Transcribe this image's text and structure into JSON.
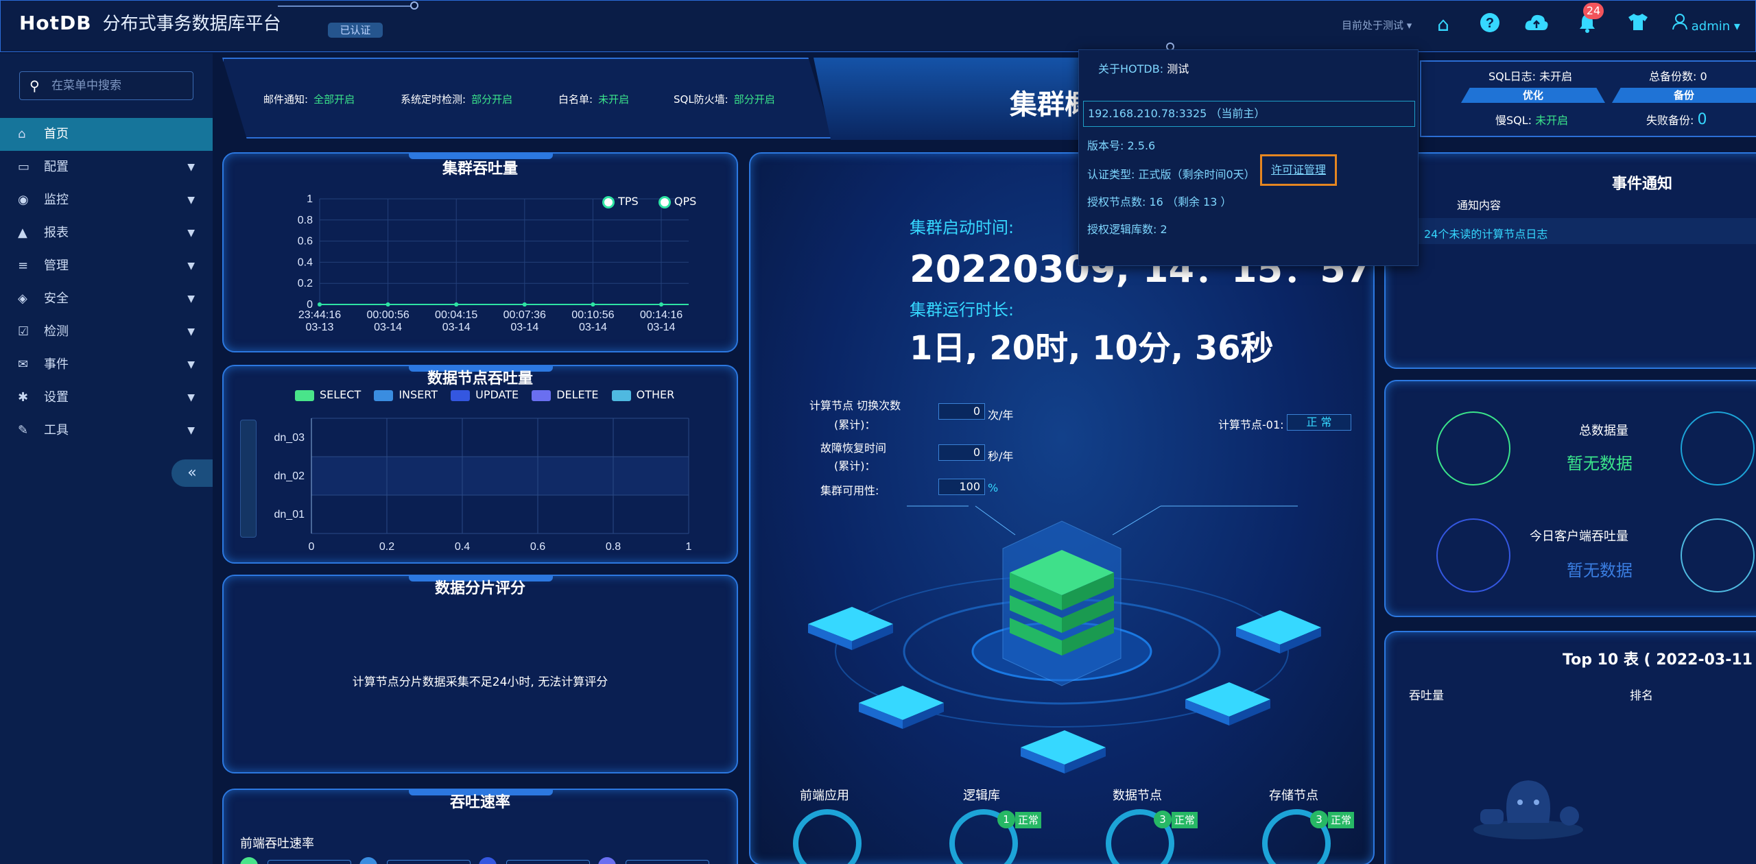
{
  "header": {
    "logo": "HotDB",
    "app_title": "分布式事务数据库平台",
    "cert_badge": "已认证",
    "env_selector": "目前处于测试",
    "notification_count": "24",
    "user": "admin",
    "icons": [
      "home-icon",
      "help-icon",
      "cloud-upload-icon",
      "bell-icon",
      "tshirt-icon",
      "user-icon"
    ]
  },
  "sidebar": {
    "search_placeholder": "在菜单中搜索",
    "collapse_label": "«",
    "items": [
      {
        "label": "首页",
        "icon": "home-icon",
        "active": true
      },
      {
        "label": "配置",
        "icon": "monitor-icon"
      },
      {
        "label": "监控",
        "icon": "eye-icon"
      },
      {
        "label": "报表",
        "icon": "chart-icon"
      },
      {
        "label": "管理",
        "icon": "database-icon"
      },
      {
        "label": "安全",
        "icon": "shield-icon"
      },
      {
        "label": "检测",
        "icon": "check-icon"
      },
      {
        "label": "事件",
        "icon": "mail-icon"
      },
      {
        "label": "设置",
        "icon": "gear-icon"
      },
      {
        "label": "工具",
        "icon": "wrench-icon"
      }
    ]
  },
  "settings_strip": [
    {
      "label": "邮件通知:",
      "value": "全部开启"
    },
    {
      "label": "系统定时检测:",
      "value": "部分开启"
    },
    {
      "label": "白名单:",
      "value": "未开启"
    },
    {
      "label": "SQL防火墙:",
      "value": "部分开启"
    }
  ],
  "center_title": "集群概",
  "right_strip": {
    "sql_log_label": "SQL日志:",
    "sql_log_value": "未开启",
    "optimize_label": "优化",
    "slow_sql_label": "慢SQL:",
    "slow_sql_value": "未开启",
    "backup_total_label": "总备份数:",
    "backup_total_value": "0",
    "backup_label": "备份",
    "backup_failed_label": "失败备份:",
    "backup_failed_value": "0"
  },
  "throughput_panel": {
    "title": "集群吞吐量",
    "chart_data": {
      "type": "line",
      "x": [
        "23:44:16 03-13",
        "00:00:56 03-14",
        "00:04:15 03-14",
        "00:07:36 03-14",
        "00:10:56 03-14",
        "00:14:16 03-14"
      ],
      "series": [
        {
          "name": "TPS",
          "values": [
            0,
            0,
            0,
            0,
            0,
            0
          ]
        },
        {
          "name": "QPS",
          "values": [
            0,
            0,
            0,
            0,
            0,
            0
          ]
        }
      ],
      "y_ticks": [
        "1",
        "0.8",
        "0.6",
        "0.4",
        "0.2",
        "0"
      ],
      "ylim": [
        0,
        1
      ],
      "legend_position": "top-right"
    }
  },
  "datanode_panel": {
    "title": "数据节点吞吐量",
    "chart_data": {
      "type": "bar",
      "categories": [
        "dn_03",
        "dn_02",
        "dn_01"
      ],
      "series": [
        {
          "name": "SELECT",
          "values": [
            0,
            0,
            0
          ]
        },
        {
          "name": "INSERT",
          "values": [
            0,
            0,
            0
          ]
        },
        {
          "name": "UPDATE",
          "values": [
            0,
            0,
            0
          ]
        },
        {
          "name": "DELETE",
          "values": [
            0,
            0,
            0
          ]
        },
        {
          "name": "OTHER",
          "values": [
            0,
            0,
            0
          ]
        }
      ],
      "x_ticks": [
        "0",
        "0.2",
        "0.4",
        "0.6",
        "0.8",
        "1"
      ],
      "xlim": [
        0,
        1
      ],
      "colors": [
        "#49e48a",
        "#3a8de0",
        "#3457e0",
        "#6a6ff0",
        "#4fb9e0"
      ]
    }
  },
  "shard_panel": {
    "title": "数据分片评分",
    "message": "计算节点分片数据采集不足24小时, 无法计算评分"
  },
  "rate_panel": {
    "title": "吞吐速率",
    "subtitle": "前端吞吐速率"
  },
  "cluster": {
    "start_label": "集群启动时间:",
    "start_value": "20220309, 14：15：57",
    "uptime_label": "集群运行时长:",
    "uptime_value": "1日, 20时, 10分, 36秒",
    "switch_label": "计算节点 切换次数",
    "switch_sub": "(累计)：",
    "switch_value": "0",
    "switch_unit": "次/年",
    "recovery_label": "故障恢复时间",
    "recovery_sub": "(累计)：",
    "recovery_value": "0",
    "recovery_unit": "秒/年",
    "availability_label": "集群可用性:",
    "availability_value": "100",
    "availability_unit": "%",
    "node_label": "计算节点-01:",
    "node_status": "正 常",
    "bottom_nodes": [
      {
        "label": "前端应用",
        "count": "",
        "status": ""
      },
      {
        "label": "逻辑库",
        "count": "1",
        "status": "正常"
      },
      {
        "label": "数据节点",
        "count": "3",
        "status": "正常"
      },
      {
        "label": "存储节点",
        "count": "3",
        "status": "正常"
      }
    ]
  },
  "events": {
    "title": "事件通知",
    "column": "通知内容",
    "item": "24个未读的计算节点日志"
  },
  "data_stats": {
    "total_label": "总数据量",
    "total_value": "暂无数据",
    "client_label": "今日客户端吞吐量",
    "client_value": "暂无数据"
  },
  "top10": {
    "title": "Top 10 表 ( 2022-03-11 )",
    "col1": "吞吐量",
    "col2": "排名"
  },
  "popup": {
    "about": "关于HOTDB:",
    "about_value": "测试",
    "host": "192.168.210.78:3325 （当前主）",
    "version_label": "版本号:",
    "version_value": "2.5.6",
    "cert_label": "认证类型:",
    "cert_value": "正式版（剩余时间0天）",
    "license_link": "许可证管理",
    "nodes_label": "授权节点数:",
    "nodes_value": "16 （剩余 13 ）",
    "libs_label": "授权逻辑库数:",
    "libs_value": "2"
  }
}
